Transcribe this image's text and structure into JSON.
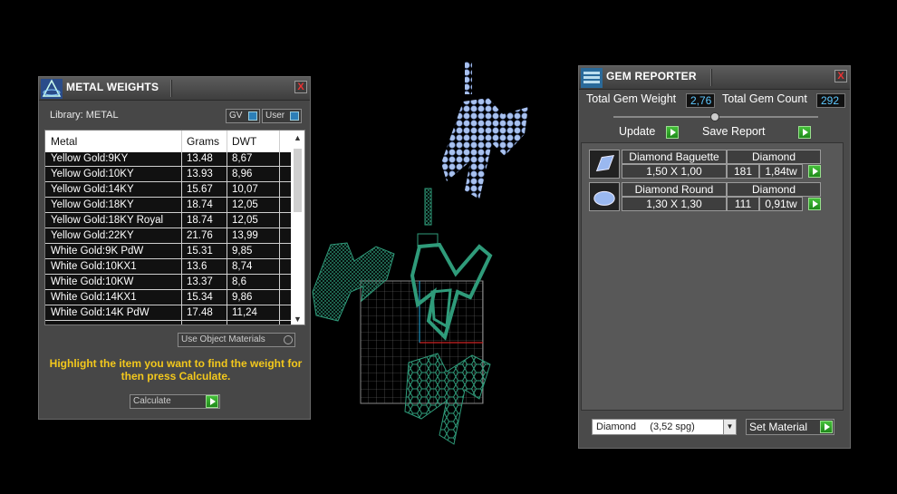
{
  "metal_panel": {
    "title": "METAL WEIGHTS",
    "close": "X",
    "library_label": "Library: METAL",
    "gv_label": "GV",
    "user_label": "User",
    "columns": [
      "Metal",
      "Grams",
      "DWT"
    ],
    "rows": [
      {
        "metal": "Yellow Gold:9KY",
        "grams": "13.48",
        "dwt": "8,67"
      },
      {
        "metal": "Yellow Gold:10KY",
        "grams": "13.93",
        "dwt": "8,96"
      },
      {
        "metal": "Yellow Gold:14KY",
        "grams": "15.67",
        "dwt": "10,07"
      },
      {
        "metal": "Yellow Gold:18KY",
        "grams": "18.74",
        "dwt": "12,05"
      },
      {
        "metal": "Yellow Gold:18KY Royal",
        "grams": "18.74",
        "dwt": "12,05"
      },
      {
        "metal": "Yellow Gold:22KY",
        "grams": "21.76",
        "dwt": "13,99"
      },
      {
        "metal": "White Gold:9K PdW",
        "grams": "15.31",
        "dwt": "9,85"
      },
      {
        "metal": "White Gold:10KX1",
        "grams": "13.6",
        "dwt": "8,74"
      },
      {
        "metal": "White Gold:10KW",
        "grams": "13.37",
        "dwt": "8,6"
      },
      {
        "metal": "White Gold:14KX1",
        "grams": "15.34",
        "dwt": "9,86"
      },
      {
        "metal": "White Gold:14K PdW",
        "grams": "17.48",
        "dwt": "11,24"
      }
    ],
    "use_object_materials": "Use Object Materials",
    "hint": "Highlight the item you want to find the weight for then press Calculate.",
    "calculate_label": "Calculate"
  },
  "gem_panel": {
    "title": "GEM REPORTER",
    "close": "X",
    "total_weight_label": "Total Gem Weight",
    "total_weight_value": "2,76",
    "total_count_label": "Total Gem Count",
    "total_count_value": "292",
    "update_label": "Update",
    "save_report_label": "Save Report",
    "gems": [
      {
        "name": "Diamond Baguette",
        "material": "Diamond",
        "size": "1,50 X 1,00",
        "count": "181",
        "weight": "1,84tw",
        "icon": "baguette-gem-icon"
      },
      {
        "name": "Diamond Round",
        "material": "Diamond",
        "size": "1,30 X 1,30",
        "count": "111",
        "weight": "0,91tw",
        "icon": "round-gem-icon"
      }
    ],
    "material_select": "Diamond     (3,52 spg)",
    "set_material_label": "Set Material"
  },
  "colors": {
    "accent_green": "#2faa25",
    "hint_yellow": "#f3c81c",
    "value_blue": "#5ec8ff",
    "model_green": "#2f9b7a",
    "gem_blue": "#9eb8e8"
  }
}
